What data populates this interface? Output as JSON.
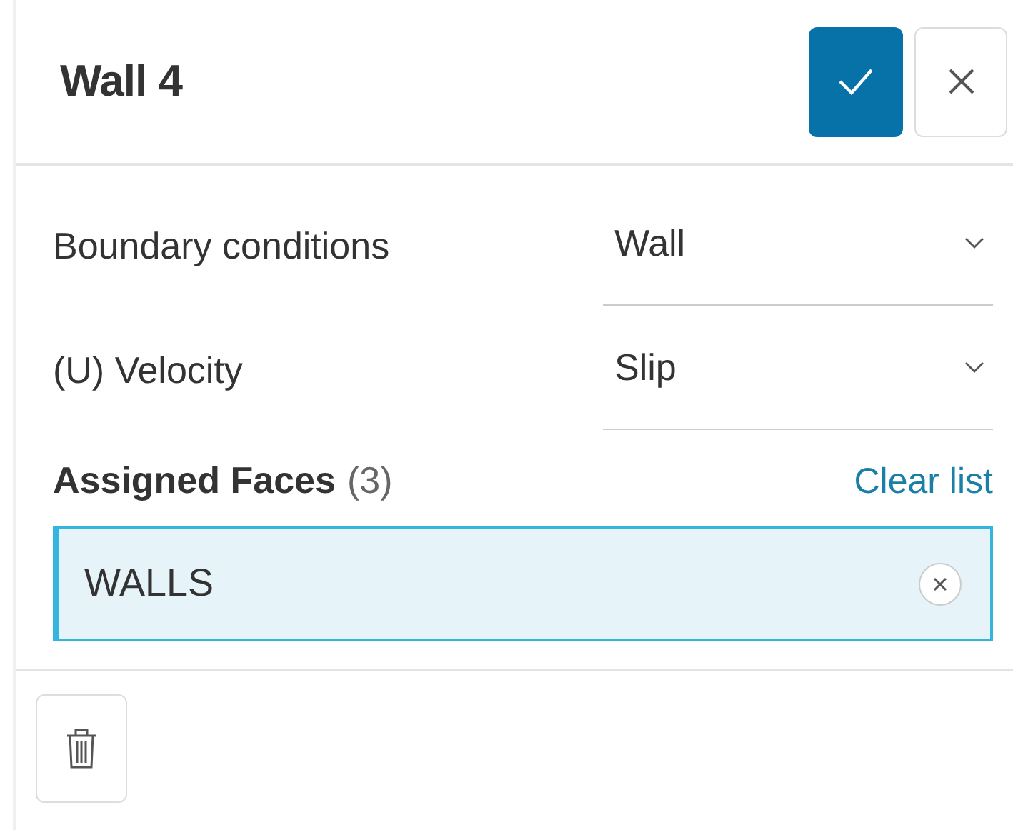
{
  "header": {
    "title": "Wall 4"
  },
  "fields": [
    {
      "label": "Boundary conditions",
      "value": "Wall"
    },
    {
      "label": "(U) Velocity",
      "value": "Slip"
    }
  ],
  "assigned": {
    "title": "Assigned Faces",
    "count": "(3)",
    "action": "Clear list",
    "items": [
      {
        "label": "WALLS",
        "selected": true
      }
    ]
  }
}
